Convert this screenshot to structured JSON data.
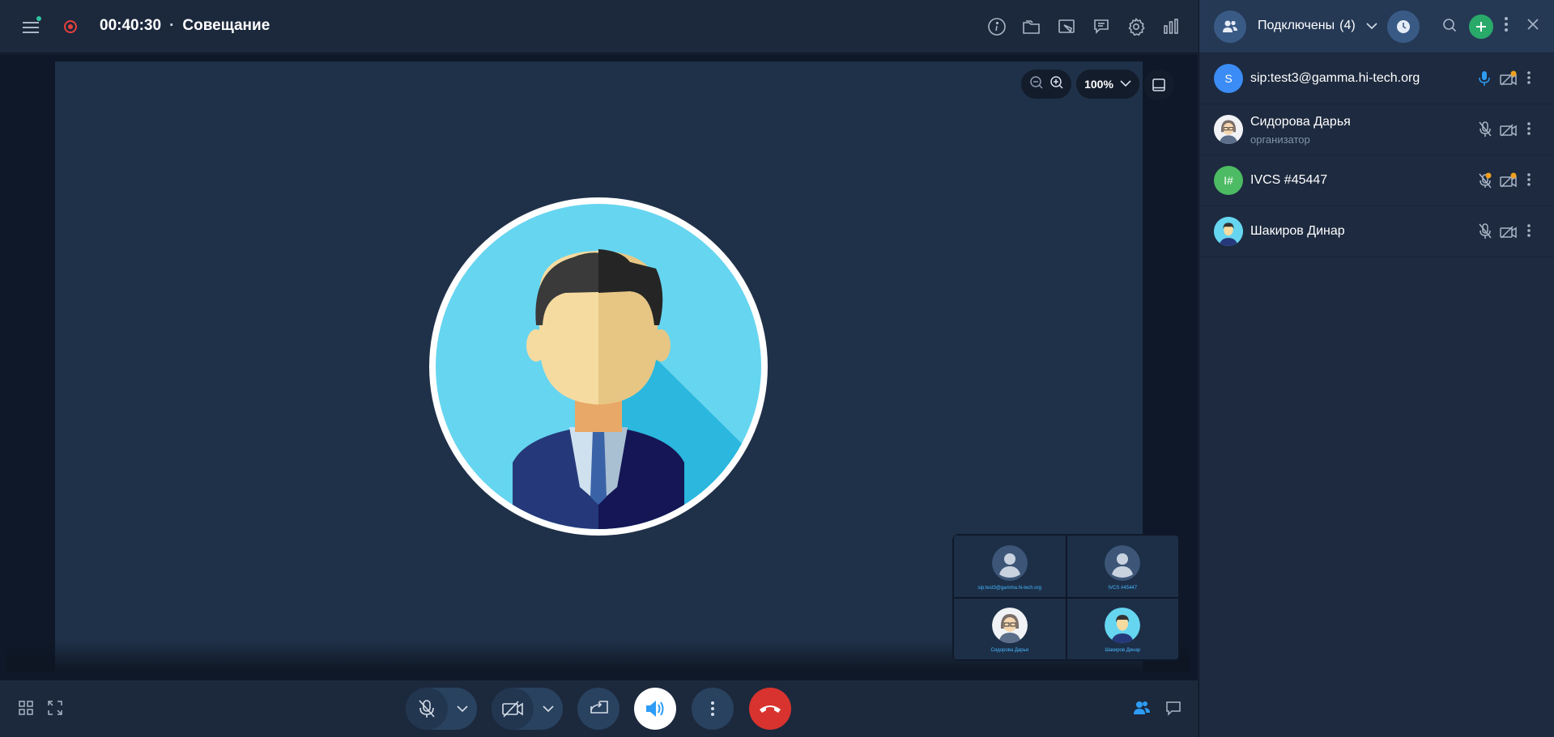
{
  "header": {
    "timer": "00:40:30",
    "separator": "·",
    "meeting_title": "Совещание",
    "icons": [
      "info-icon",
      "folder-icon",
      "whiteboard-icon",
      "chat-feedback-icon",
      "settings-icon",
      "stats-icon"
    ]
  },
  "zoom": {
    "level": "100%"
  },
  "mini_grid": {
    "tiles": [
      {
        "label": "sip:test3@gamma.hi-tech.org"
      },
      {
        "label": "IVCS #45447"
      },
      {
        "label": "Сидорова Дарья"
      },
      {
        "label": "Шакиров Динар"
      }
    ]
  },
  "panel": {
    "title": "Подключены",
    "count": "(4)",
    "participants": [
      {
        "avatar_text": "S",
        "avatar_color": "#3b8cf5",
        "name": "sip:test3@gamma.hi-tech.org",
        "role": "",
        "mic": "active",
        "cam": "locked"
      },
      {
        "avatar_text": "",
        "avatar_color": "#d8dde4",
        "name": "Сидорова Дарья",
        "role": "организатор",
        "mic": "off",
        "cam": "off"
      },
      {
        "avatar_text": "I#",
        "avatar_color": "#4cbb63",
        "name": "IVCS #45447",
        "role": "",
        "mic": "locked",
        "cam": "locked"
      },
      {
        "avatar_text": "",
        "avatar_color": "#66d5f0",
        "name": "Шакиров Динар",
        "role": "",
        "mic": "off",
        "cam": "off"
      }
    ]
  },
  "colors": {
    "accent": "#2aaa6a",
    "hangup": "#d8332e",
    "active_blue": "#2d9cf5",
    "lock_badge": "#f0a020"
  }
}
